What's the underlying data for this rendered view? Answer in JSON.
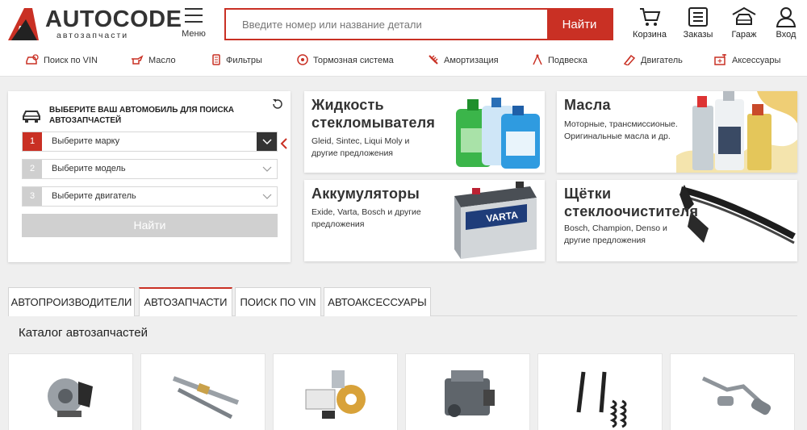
{
  "brand": {
    "name": "AUTOCODE",
    "subtitle": "автозапчасти"
  },
  "header": {
    "menu_label": "Меню",
    "search_placeholder": "Введите номер или название детали",
    "search_button": "Найти",
    "icons": [
      {
        "name": "cart-icon",
        "label": "Корзина"
      },
      {
        "name": "orders-icon",
        "label": "Заказы"
      },
      {
        "name": "garage-icon",
        "label": "Гараж"
      },
      {
        "name": "user-icon",
        "label": "Вход"
      }
    ]
  },
  "nav": {
    "items": [
      {
        "label": "Поиск по VIN",
        "icon": "vin-car-icon"
      },
      {
        "label": "Масло",
        "icon": "oil-can-icon"
      },
      {
        "label": "Фильтры",
        "icon": "filter-icon"
      },
      {
        "label": "Тормозная система",
        "icon": "brake-disc-icon"
      },
      {
        "label": "Амортизация",
        "icon": "shock-absorber-icon"
      },
      {
        "label": "Подвеска",
        "icon": "suspension-icon"
      },
      {
        "label": "Двигатель",
        "icon": "engine-icon"
      },
      {
        "label": "Аксессуары",
        "icon": "accessories-icon"
      }
    ]
  },
  "selector": {
    "title": "Выберите ваш автомобиль для поиска автозапчастей",
    "steps": [
      {
        "num": "1",
        "label": "Выберите марку"
      },
      {
        "num": "2",
        "label": "Выберите модель"
      },
      {
        "num": "3",
        "label": "Выберите двигатель"
      }
    ],
    "find_button": "Найти"
  },
  "promos": [
    {
      "title": "Жидкость стекломывателя",
      "desc": "Gleid, Sintec, Liqui Moly и другие предложения"
    },
    {
      "title": "Масла",
      "desc": "Моторные, трансмиссионые. Оригинальные масла и др."
    },
    {
      "title": "Аккумуляторы",
      "desc": "Exide, Varta, Bosch и другие предложения",
      "brand_label": "VARTA"
    },
    {
      "title": "Щётки стеклоочистителя",
      "desc": "Bosch, Champion, Denso и другие предложения"
    }
  ],
  "tabs": [
    {
      "label": "АВТОПРОИЗВОДИТЕЛИ"
    },
    {
      "label": "АВТОЗАПЧАСТИ"
    },
    {
      "label": "ПОИСК ПО VIN"
    },
    {
      "label": "АВТОАКСЕССУАРЫ"
    }
  ],
  "catalog": {
    "title": "Каталог автозапчастей",
    "items": [
      "brake-disc-image",
      "glow-plug-image",
      "filters-image",
      "engine-image",
      "shock-absorbers-image",
      "exhaust-image"
    ]
  },
  "colors": {
    "accent": "#c93024",
    "background": "#efefef"
  }
}
